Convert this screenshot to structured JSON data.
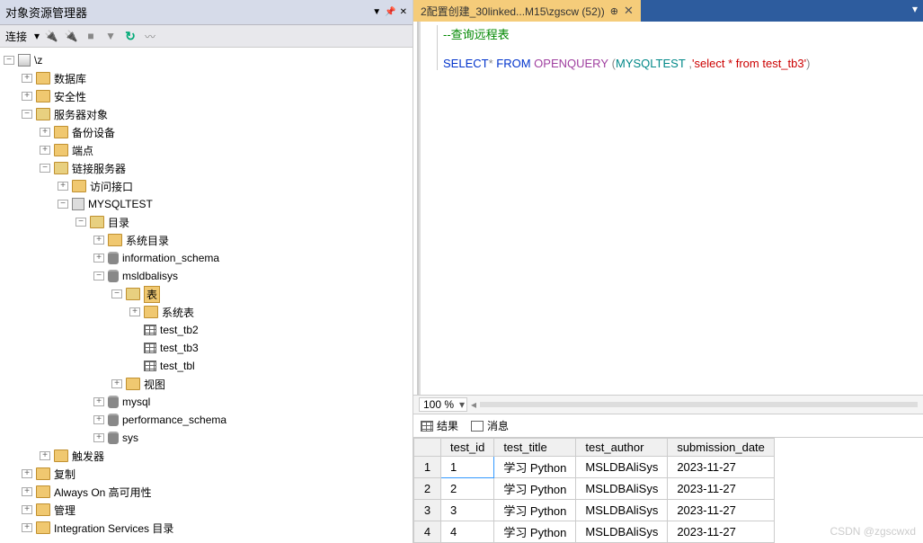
{
  "left_panel": {
    "title": "对象资源管理器",
    "toolbar": {
      "connect_label": "连接"
    },
    "tree": {
      "server_redacted": "                                                           \\z",
      "nodes": {
        "database": "数据库",
        "security": "安全性",
        "server_objects": "服务器对象",
        "backup_devices": "备份设备",
        "endpoints": "端点",
        "linked_servers": "链接服务器",
        "access_interface": "访问接口",
        "mysqltest": "MYSQLTEST",
        "catalogs": "目录",
        "system_catalogs": "系统目录",
        "information_schema": "information_schema",
        "msldbalisys": "msldbalisys",
        "tables_sel": "表",
        "system_tables": "系统表",
        "test_tb2": "test_tb2",
        "test_tb3": "test_tb3",
        "test_tbl": "test_tbl",
        "views": "视图",
        "mysql": "mysql",
        "performance_schema": "performance_schema",
        "sys": "sys",
        "triggers": "触发器",
        "replication": "复制",
        "alwayson": "Always On 高可用性",
        "management": "管理",
        "is_catalogs": "Integration Services 目录"
      }
    }
  },
  "tab": {
    "label": "2配置创建_30linked...M15\\zgscw (52))"
  },
  "editor": {
    "comment": "--查询远程表",
    "sql": {
      "select": "SELECT",
      "star": "*",
      "from": "FROM",
      "openquery": "OPENQUERY",
      "id": "MYSQLTEST",
      "str": "'select * from test_tb3'"
    }
  },
  "zoom": "100 %",
  "result_tabs": {
    "results": "结果",
    "messages": "消息"
  },
  "grid": {
    "headers": [
      "",
      "test_id",
      "test_title",
      "test_author",
      "submission_date"
    ],
    "rows": [
      {
        "n": "1",
        "id": "1",
        "title": "学习 Python",
        "author": "MSLDBAliSys",
        "date": "2023-11-27"
      },
      {
        "n": "2",
        "id": "2",
        "title": "学习 Python",
        "author": "MSLDBAliSys",
        "date": "2023-11-27"
      },
      {
        "n": "3",
        "id": "3",
        "title": "学习 Python",
        "author": "MSLDBAliSys",
        "date": "2023-11-27"
      },
      {
        "n": "4",
        "id": "4",
        "title": "学习 Python",
        "author": "MSLDBAliSys",
        "date": "2023-11-27"
      }
    ]
  },
  "watermark": "CSDN @zgscwxd"
}
